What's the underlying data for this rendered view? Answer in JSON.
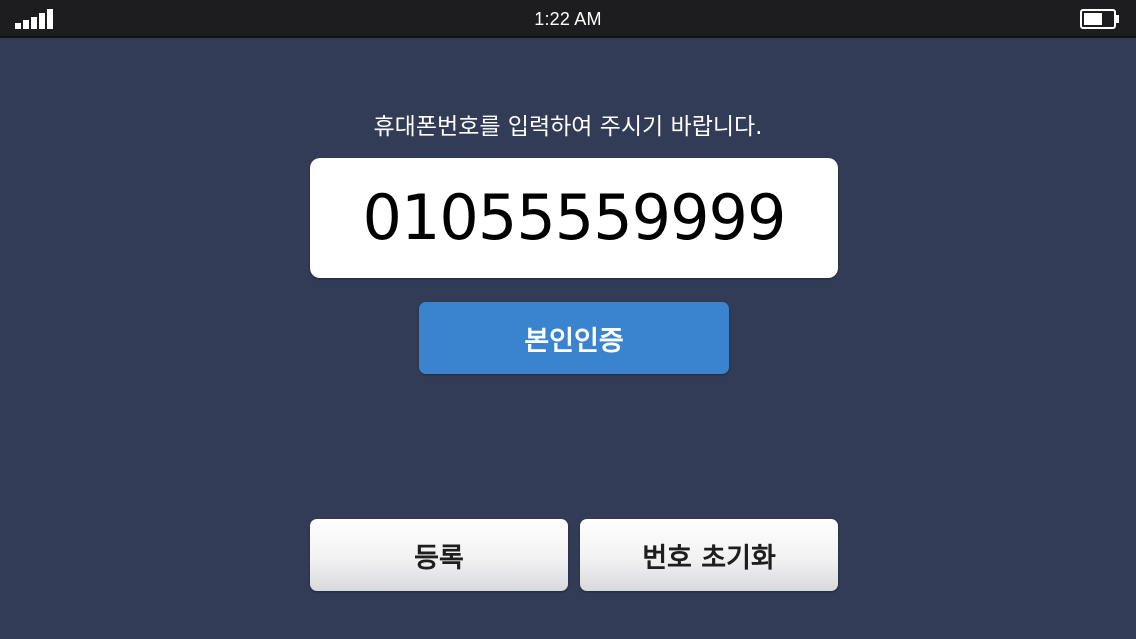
{
  "status_bar": {
    "time": "1:22 AM",
    "signal_icon": "cellular-signal-icon",
    "battery_icon": "battery-icon"
  },
  "main": {
    "prompt": "휴대폰번호를 입력하여 주시기 바랍니다.",
    "phone_number": "01055559999",
    "verify_label": "본인인증",
    "register_label": "등록",
    "reset_label": "번호 초기화"
  },
  "colors": {
    "background": "#323c56",
    "status_bar": "#1d1d1f",
    "verify_button": "#3a84cf",
    "display_bg": "#ffffff"
  }
}
